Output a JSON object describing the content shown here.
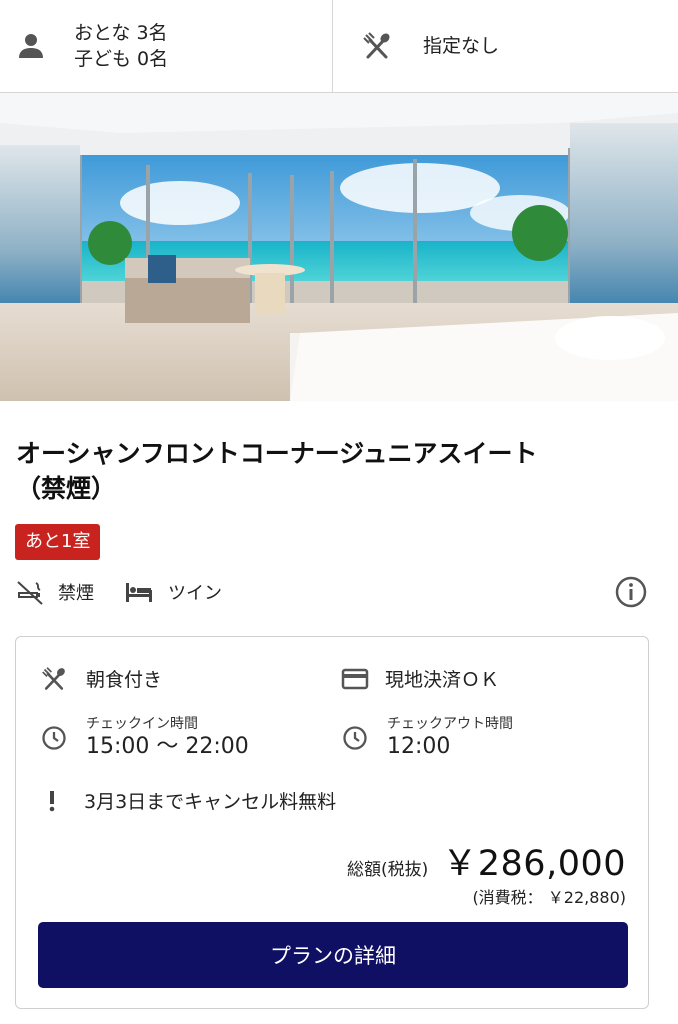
{
  "search": {
    "adults_label": "おとな 3名",
    "children_label": "子ども 0名",
    "meal_filter_label": "指定なし"
  },
  "room": {
    "name_line1": "オーシャンフロントコーナージュニアスイート",
    "name_line2": "（禁煙）",
    "availability_badge": "あと1室",
    "smoking_label": "禁煙",
    "bed_label": "ツイン",
    "badge_color": "#c8231f"
  },
  "plan": {
    "meal_label": "朝食付き",
    "payment_label": "現地決済ＯＫ",
    "checkin_caption": "チェックイン時間",
    "checkin_time": "15:00 〜 22:00",
    "checkout_caption": "チェックアウト時間",
    "checkout_time": "12:00",
    "cancel_policy": "3月3日までキャンセル料無料",
    "total_label": "総額(税抜)",
    "total_price": "￥286,000",
    "tax_note": "(消費税： ￥22,880)",
    "detail_button_label": "プランの詳細",
    "button_color": "#0f1063"
  },
  "icons": [
    "person-icon",
    "fork-knife-icon",
    "no-smoking-icon",
    "bed-icon",
    "info-icon",
    "credit-card-icon",
    "clock-icon",
    "exclamation-icon"
  ]
}
